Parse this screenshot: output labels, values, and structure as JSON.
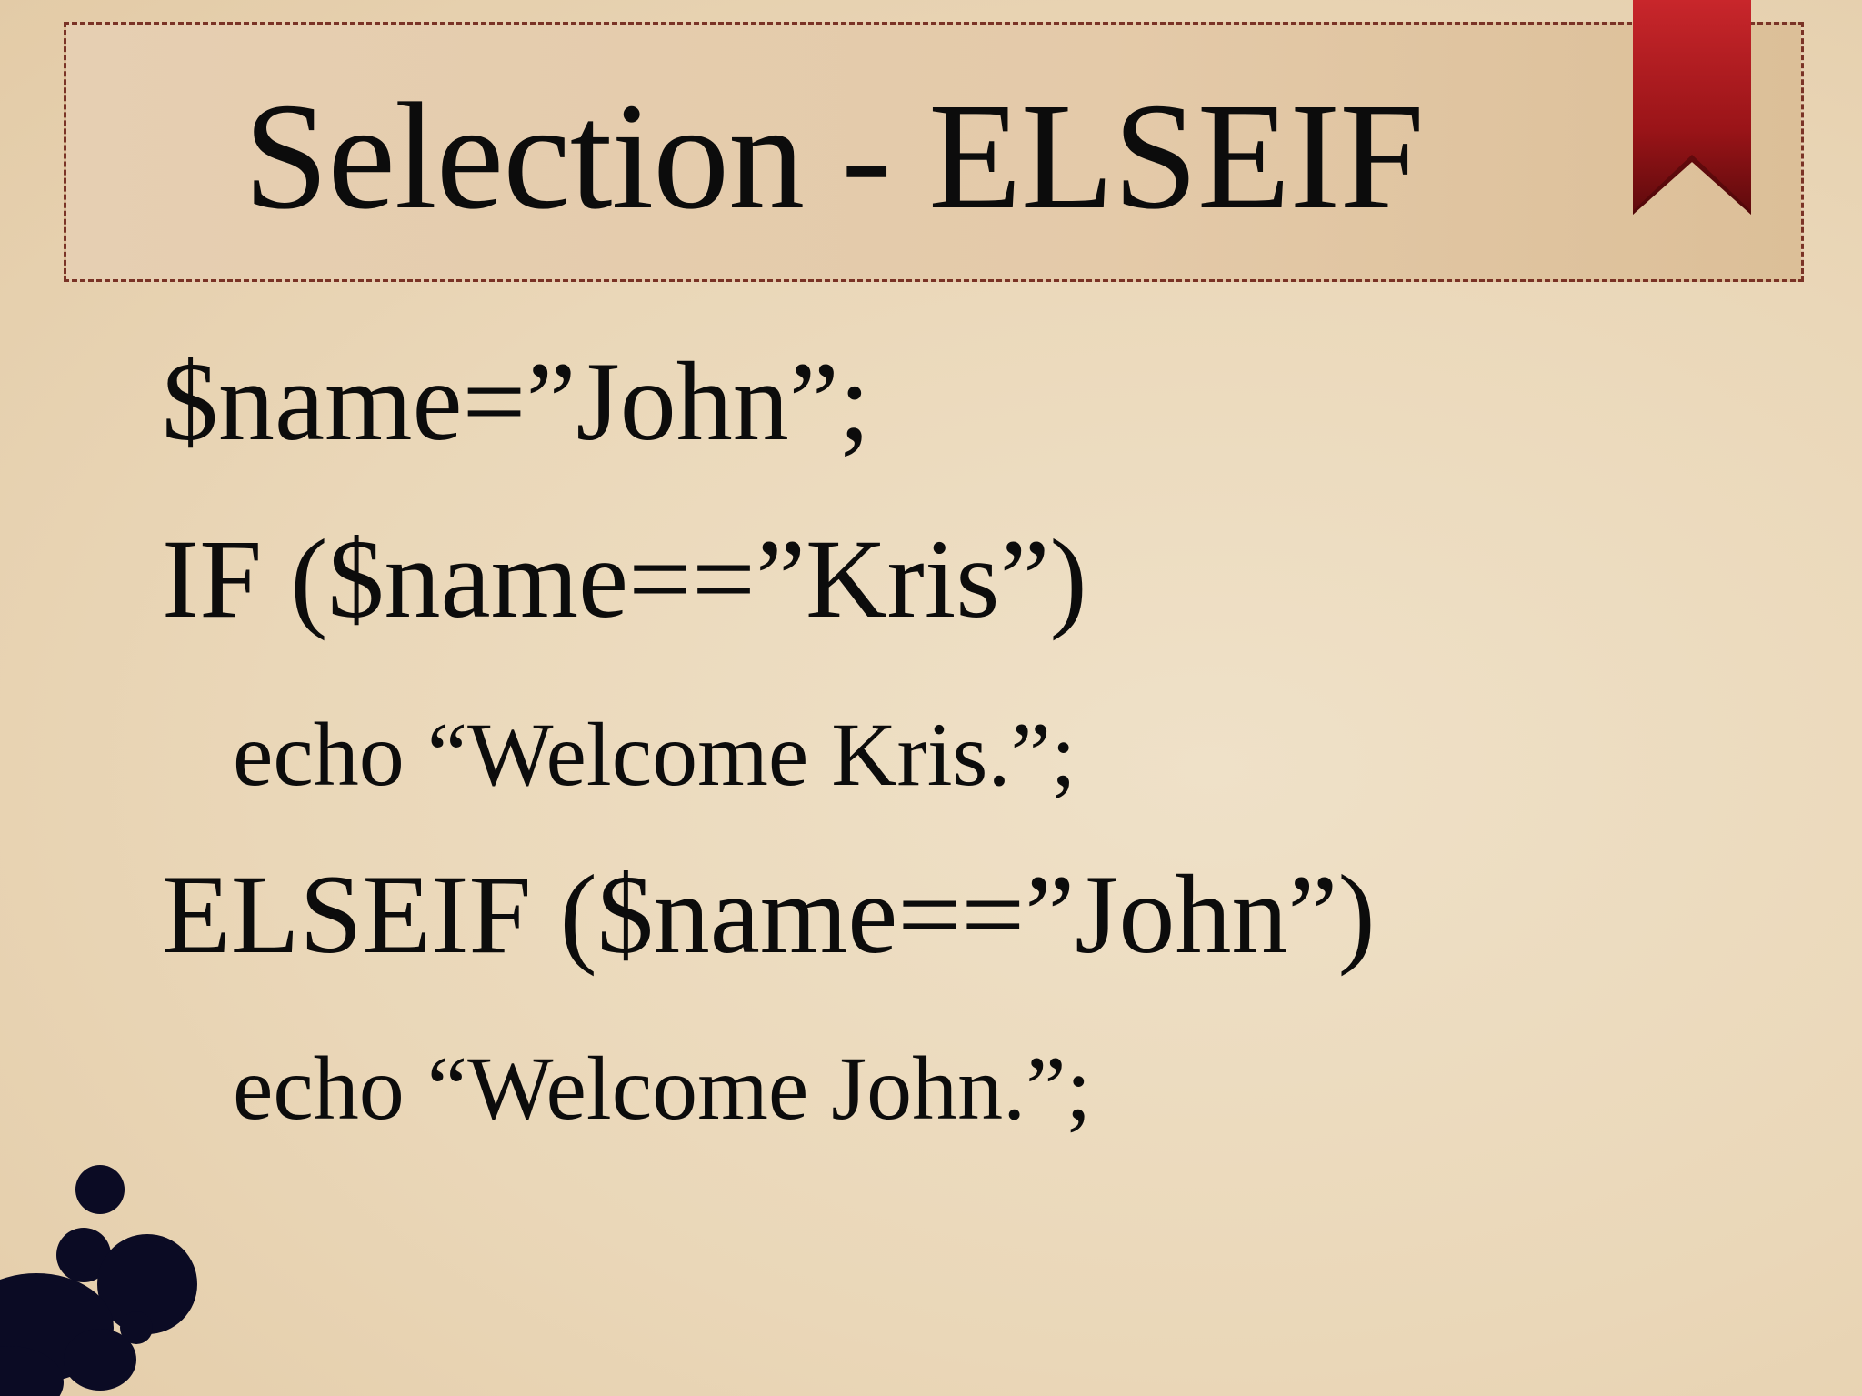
{
  "slide": {
    "title": "Selection - ELSEIF",
    "code_lines": [
      "$name=”John”;",
      "IF ($name==”Kris”)",
      "echo “Welcome Kris.”;",
      "ELSEIF ($name==”John”)",
      "echo “Welcome John.”;"
    ]
  },
  "colors": {
    "background": "#ead7b8",
    "title_border": "#7a3326",
    "ribbon": "#a8151c",
    "splatter": "#0b0b24"
  },
  "icons": {
    "ribbon": "bookmark-ribbon-icon",
    "decoration": "ink-splatter-icon"
  }
}
